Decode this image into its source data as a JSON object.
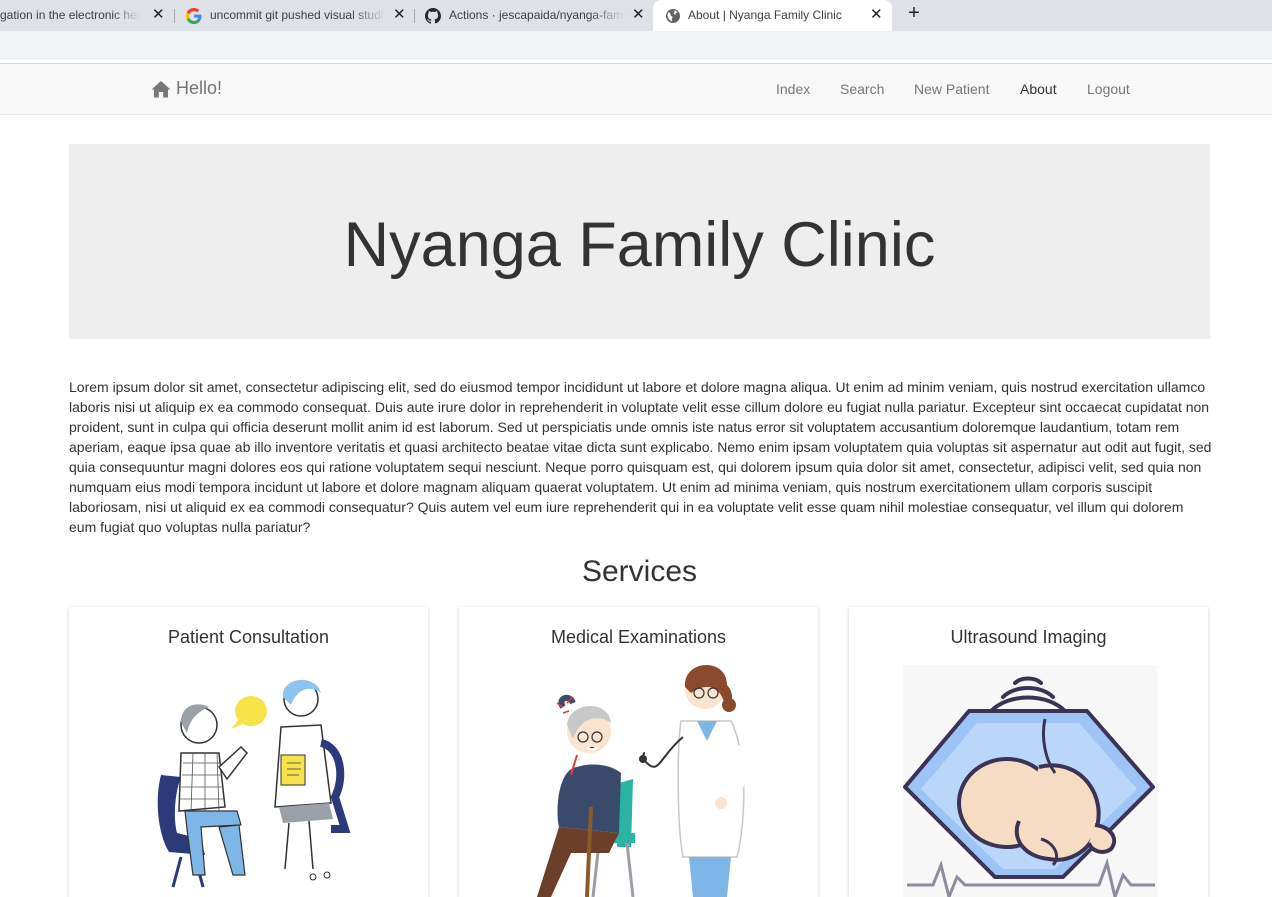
{
  "browser": {
    "tabs": [
      {
        "title": "gation in the electronic healt",
        "close": "✕"
      },
      {
        "title": "uncommit git pushed visual studi",
        "close": "✕"
      },
      {
        "title": "Actions · jescapaida/nyanga-fami",
        "close": "✕"
      },
      {
        "title": "About | Nyanga Family Clinic",
        "close": "✕"
      }
    ],
    "new_tab": "+"
  },
  "navbar": {
    "brand": "Hello!",
    "links": [
      {
        "label": "Index"
      },
      {
        "label": "Search"
      },
      {
        "label": "New Patient"
      },
      {
        "label": "About"
      },
      {
        "label": "Logout"
      }
    ],
    "active": "About"
  },
  "jumbotron": {
    "title": "Nyanga Family Clinic"
  },
  "body_text": "Lorem ipsum dolor sit amet, consectetur adipiscing elit, sed do eiusmod tempor incididunt ut labore et dolore magna aliqua. Ut enim ad minim veniam, quis nostrud exercitation ullamco laboris nisi ut aliquip ex ea commodo consequat. Duis aute irure dolor in reprehenderit in voluptate velit esse cillum dolore eu fugiat nulla pariatur. Excepteur sint occaecat cupidatat non proident, sunt in culpa qui officia deserunt mollit anim id est laborum. Sed ut perspiciatis unde omnis iste natus error sit voluptatem accusantium doloremque laudantium, totam rem aperiam, eaque ipsa quae ab illo inventore veritatis et quasi architecto beatae vitae dicta sunt explicabo. Nemo enim ipsam voluptatem quia voluptas sit aspernatur aut odit aut fugit, sed quia consequuntur magni dolores eos qui ratione voluptatem sequi nesciunt. Neque porro quisquam est, qui dolorem ipsum quia dolor sit amet, consectetur, adipisci velit, sed quia non numquam eius modi tempora incidunt ut labore et dolore magnam aliquam quaerat voluptatem. Ut enim ad minima veniam, quis nostrum exercitationem ullam corporis suscipit laboriosam, nisi ut aliquid ex ea commodi consequatur? Quis autem vel eum iure reprehenderit qui in ea voluptate velit esse quam nihil molestiae consequatur, vel illum qui dolorem eum fugiat quo voluptas nulla pariatur?",
  "services": {
    "title": "Services",
    "cards": [
      {
        "title": "Patient Consultation",
        "image": "consultation-illustration"
      },
      {
        "title": "Medical Examinations",
        "image": "examination-illustration"
      },
      {
        "title": "Ultrasound Imaging",
        "image": "ultrasound-illustration"
      }
    ]
  },
  "colors": {
    "tabstrip": "#dee1e6",
    "navbar_bg": "#f8f8f8",
    "nav_text": "#777777",
    "nav_active": "#333333",
    "jumbotron_bg": "#eeeeee"
  }
}
